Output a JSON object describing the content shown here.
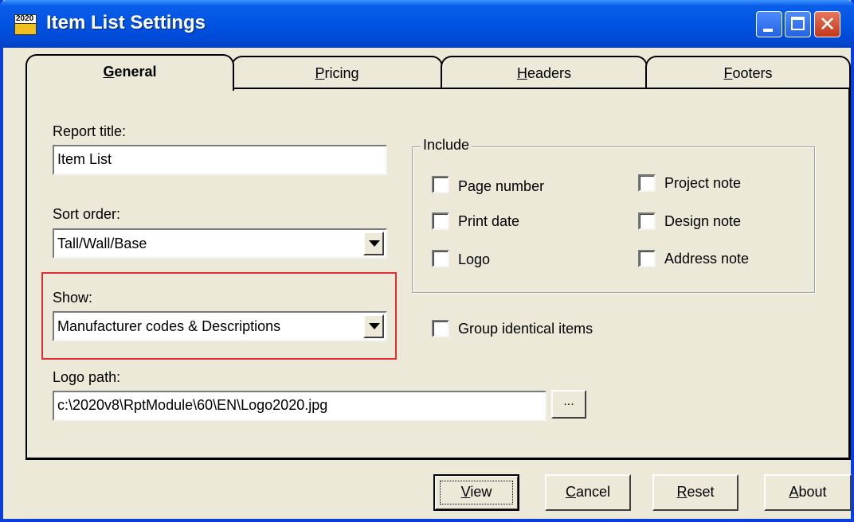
{
  "window": {
    "title": "Item List Settings",
    "icon_label": "2020"
  },
  "tabs": [
    {
      "label": "General",
      "underline": "G",
      "rest": "eneral",
      "selected": true
    },
    {
      "label": "Pricing",
      "underline": "P",
      "rest": "ricing",
      "selected": false
    },
    {
      "label": "Headers",
      "underline": "H",
      "rest": "eaders",
      "selected": false
    },
    {
      "label": "Footers",
      "underline": "F",
      "rest": "ooters",
      "selected": false
    }
  ],
  "general": {
    "report_title_label": "Report title:",
    "report_title_value": "Item List",
    "sort_order_label": "Sort order:",
    "sort_order_value": "Tall/Wall/Base",
    "show_label": "Show:",
    "show_value": "Manufacturer codes & Descriptions",
    "logo_path_label": "Logo path:",
    "logo_path_value": "c:\\2020v8\\RptModule\\60\\EN\\Logo2020.jpg",
    "browse_label": "...",
    "include_legend": "Include",
    "checkboxes": {
      "page_number": {
        "label": "Page number",
        "checked": false
      },
      "print_date": {
        "label": "Print date",
        "checked": false
      },
      "logo": {
        "label": "Logo",
        "checked": false
      },
      "project_note": {
        "label": "Project note",
        "checked": false
      },
      "design_note": {
        "label": "Design note",
        "checked": false
      },
      "address_note": {
        "label": "Address note",
        "checked": false
      },
      "group_identical": {
        "label": "Group identical items",
        "checked": false
      }
    }
  },
  "buttons": {
    "view": {
      "underline": "V",
      "rest": "iew"
    },
    "cancel": {
      "underline": "C",
      "rest": "ancel"
    },
    "reset": {
      "underline": "R",
      "rest": "eset"
    },
    "about": {
      "underline": "A",
      "rest": "bout"
    }
  },
  "colors": {
    "titlebar": "#0054e3",
    "highlight": "#e03030",
    "face": "#ece9d8"
  }
}
